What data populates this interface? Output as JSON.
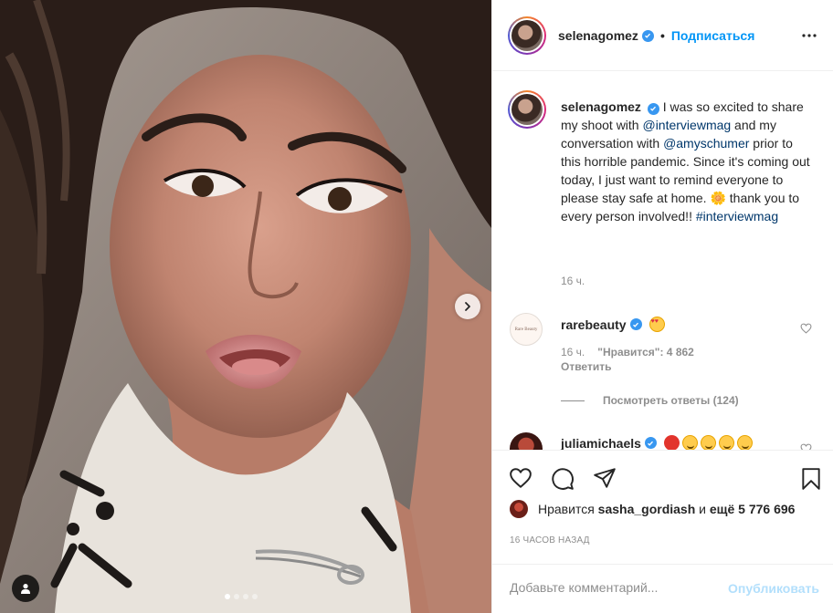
{
  "post": {
    "username": "selenagomez",
    "follow_dot": "•",
    "follow_label": "Подписаться",
    "carousel_total": 4,
    "carousel_active": 1
  },
  "caption": {
    "username": "selenagomez",
    "text_1": " I was so excited to share my shoot with ",
    "mention_1": "@interviewmag",
    "text_2": " and my conversation with ",
    "mention_2": "@amyschumer",
    "text_3": " prior to this horrible pandemic. Since it's coming out today, I just want to remind everyone to please stay safe at home. ",
    "emoji": "🌼",
    "text_4": " thank you to every person involved!! ",
    "hashtag": "#interviewmag",
    "time": "16 ч."
  },
  "comments": [
    {
      "username": "rarebeauty",
      "avatar_text": "Rare Beauty",
      "emoji": "heart-eyes",
      "time": "16 ч.",
      "likes_label": "\"Нравится\": 4 862",
      "reply_label": "Ответить",
      "view_replies": "Посмотреть ответы (124)"
    },
    {
      "username": "juliamichaels",
      "emojis": [
        "angry",
        "smile",
        "smile",
        "smile",
        "smile"
      ]
    }
  ],
  "likes": {
    "prefix": "Нравится",
    "user": "sasha_gordiash",
    "middle": "и",
    "rest": "ещё 5 776 696"
  },
  "time_ago": "16 часов назад",
  "add_comment": {
    "placeholder": "Добавьте комментарий...",
    "publish_label": "Опубликовать"
  },
  "colors": {
    "accent": "#0095f6",
    "verified": "#3897f0",
    "muted": "#8e8e8e",
    "publish_disabled": "#b2dffc"
  }
}
